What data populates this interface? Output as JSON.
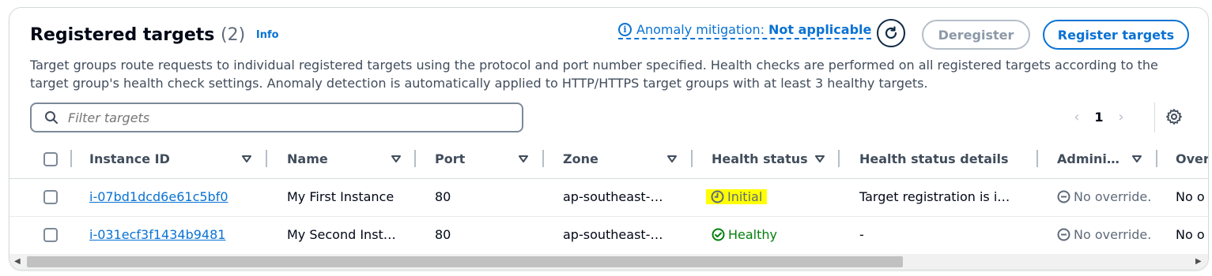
{
  "header": {
    "title": "Registered targets",
    "count": "(2)",
    "info_label": "Info",
    "anomaly_label": "Anomaly mitigation:",
    "anomaly_value": "Not applicable",
    "deregister_label": "Deregister",
    "register_label": "Register targets",
    "description": "Target groups route requests to individual registered targets using the protocol and port number specified. Health checks are performed on all registered targets according to the target group's health check settings. Anomaly detection is automatically applied to HTTP/HTTPS target groups with at least 3 healthy targets."
  },
  "filter": {
    "placeholder": "Filter targets"
  },
  "pagination": {
    "current_page": "1"
  },
  "table": {
    "columns": [
      "Instance ID",
      "Name",
      "Port",
      "Zone",
      "Health status",
      "Health status details",
      "Admini…",
      "Over"
    ],
    "rows": [
      {
        "instance_id": "i-07bd1dcd6e61c5bf0",
        "name": "My First Instance",
        "port": "80",
        "zone": "ap-southeast-…",
        "health_status": "Initial",
        "health_details": "Target registration is i…",
        "admin_override": "No override.",
        "override": "No o"
      },
      {
        "instance_id": "i-031ecf3f1434b9481",
        "name": "My Second Inst…",
        "port": "80",
        "zone": "ap-southeast-…",
        "health_status": "Healthy",
        "health_details": "-",
        "admin_override": "No override.",
        "override": "No o"
      }
    ]
  },
  "icons": {
    "info": "info-circle-icon",
    "refresh": "refresh-icon",
    "search": "search-icon",
    "settings": "gear-icon",
    "initial": "clock-icon",
    "healthy": "check-circle-icon",
    "override": "minus-circle-icon"
  },
  "colors": {
    "link": "#0972d3",
    "healthy": "#037f0c",
    "highlight": "#ffff00",
    "muted": "#5f6b7a"
  }
}
